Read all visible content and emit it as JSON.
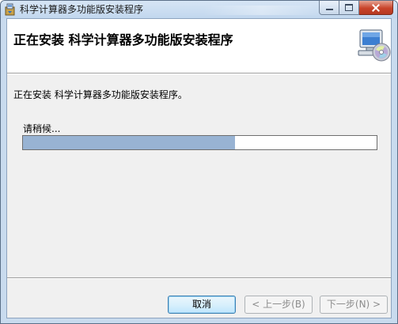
{
  "window": {
    "title": "科学计算器多功能版安装程序"
  },
  "banner": {
    "title": "正在安装 科学计算器多功能版安装程序",
    "icon": "computer-cd-icon"
  },
  "main": {
    "status_text": "正在安装 科学计算器多功能版安装程序。",
    "wait_text": "请稍候...",
    "progress": 0.6
  },
  "buttons": {
    "cancel": "取消",
    "back": "< 上一步(B)",
    "next": "下一步(N) >"
  },
  "colors": {
    "progress_fill": "#98b3d3",
    "titlebar": "#c9dbee"
  }
}
